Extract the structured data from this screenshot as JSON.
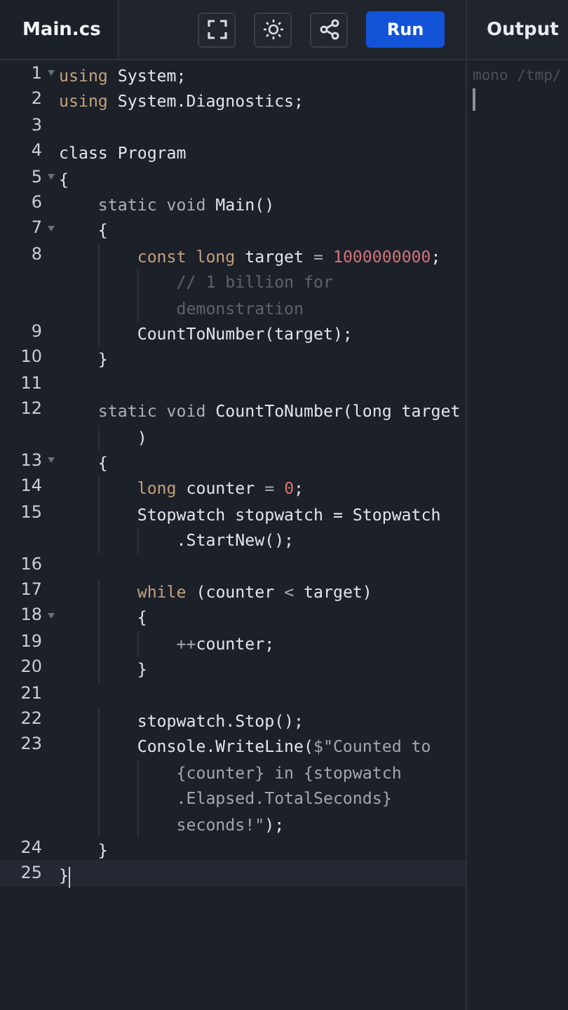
{
  "tab": {
    "label": "Main.cs",
    "selected": true
  },
  "toolbar": {
    "buttons": [
      {
        "kind": "fullscreen"
      },
      {
        "kind": "theme"
      },
      {
        "kind": "share"
      }
    ],
    "run": "Run"
  },
  "editor": {
    "lines": [
      {
        "number": "1",
        "foldable": true,
        "active": false,
        "segments": [
          {
            "tokens": [
              {
                "kind": "kw",
                "text": "using"
              },
              {
                "kind": "plain",
                "text": " System;"
              }
            ]
          }
        ]
      },
      {
        "number": "2",
        "foldable": false,
        "active": false,
        "segments": [
          {
            "tokens": [
              {
                "kind": "kw",
                "text": "using"
              },
              {
                "kind": "plain",
                "text": " System.Diagnostics;"
              }
            ]
          }
        ]
      },
      {
        "number": "3",
        "foldable": false,
        "active": false
      },
      {
        "number": "4",
        "foldable": false,
        "active": false,
        "segments": [
          {
            "tokens": [
              {
                "kind": "plain",
                "text": "class Program"
              }
            ]
          }
        ]
      },
      {
        "number": "5",
        "foldable": true,
        "active": false,
        "segments": [
          {
            "tokens": [
              {
                "kind": "plain",
                "text": "{"
              }
            ]
          }
        ]
      },
      {
        "number": "6",
        "foldable": false,
        "active": false,
        "segments": [
          {
            "tokens": [
              {
                "kind": "decl",
                "text": "    static void"
              },
              {
                "kind": "plain",
                "text": " Main()"
              }
            ]
          }
        ]
      },
      {
        "number": "7",
        "foldable": true,
        "active": false,
        "segments": [
          {
            "tokens": [
              {
                "kind": "plain",
                "text": "    {"
              }
            ]
          }
        ]
      },
      {
        "number": "8",
        "foldable": false,
        "active": false,
        "segments": [
          {
            "tokens": [
              {
                "kind": "kw",
                "text": "        const long"
              },
              {
                "kind": "plain",
                "text": " target "
              },
              {
                "kind": "op",
                "text": "= "
              },
              {
                "kind": "num",
                "text": "1000000000"
              },
              {
                "kind": "plain",
                "text": ";"
              }
            ]
          },
          {
            "tokens": [
              {
                "kind": "comment",
                "text": "            // 1 billion for"
              }
            ]
          },
          {
            "tokens": [
              {
                "kind": "comment",
                "text": "            demonstration"
              }
            ]
          }
        ]
      },
      {
        "number": "9",
        "foldable": false,
        "active": false,
        "segments": [
          {
            "tokens": [
              {
                "kind": "plain",
                "text": "        CountToNumber(target);"
              }
            ]
          }
        ]
      },
      {
        "number": "10",
        "foldable": false,
        "active": false,
        "segments": [
          {
            "tokens": [
              {
                "kind": "plain",
                "text": "    }"
              }
            ]
          }
        ]
      },
      {
        "number": "11",
        "foldable": false,
        "active": false
      },
      {
        "number": "12",
        "foldable": false,
        "active": false,
        "segments": [
          {
            "tokens": [
              {
                "kind": "decl",
                "text": "    static void"
              },
              {
                "kind": "plain",
                "text": " CountToNumber(long target"
              }
            ]
          },
          {
            "tokens": [
              {
                "kind": "plain",
                "text": "        )"
              }
            ]
          }
        ]
      },
      {
        "number": "13",
        "foldable": true,
        "active": false,
        "segments": [
          {
            "tokens": [
              {
                "kind": "plain",
                "text": "    {"
              }
            ]
          }
        ]
      },
      {
        "number": "14",
        "foldable": false,
        "active": false,
        "segments": [
          {
            "tokens": [
              {
                "kind": "kw",
                "text": "        long"
              },
              {
                "kind": "plain",
                "text": " counter "
              },
              {
                "kind": "op",
                "text": "= "
              },
              {
                "kind": "num",
                "text": "0"
              },
              {
                "kind": "plain",
                "text": ";"
              }
            ]
          }
        ]
      },
      {
        "number": "15",
        "foldable": false,
        "active": false,
        "segments": [
          {
            "tokens": [
              {
                "kind": "plain",
                "text": "        Stopwatch stopwatch = Stopwatch"
              }
            ]
          },
          {
            "tokens": [
              {
                "kind": "plain",
                "text": "            .StartNew();"
              }
            ]
          }
        ]
      },
      {
        "number": "16",
        "foldable": false,
        "active": false
      },
      {
        "number": "17",
        "foldable": false,
        "active": false,
        "segments": [
          {
            "tokens": [
              {
                "kind": "kw",
                "text": "        while"
              },
              {
                "kind": "plain",
                "text": " (counter "
              },
              {
                "kind": "op",
                "text": "<"
              },
              {
                "kind": "plain",
                "text": " target)"
              }
            ]
          }
        ]
      },
      {
        "number": "18",
        "foldable": true,
        "active": false,
        "segments": [
          {
            "tokens": [
              {
                "kind": "plain",
                "text": "        {"
              }
            ]
          }
        ]
      },
      {
        "number": "19",
        "foldable": false,
        "active": false,
        "segments": [
          {
            "tokens": [
              {
                "kind": "op",
                "text": "            ++"
              },
              {
                "kind": "plain",
                "text": "counter;"
              }
            ]
          }
        ]
      },
      {
        "number": "20",
        "foldable": false,
        "active": false,
        "segments": [
          {
            "tokens": [
              {
                "kind": "plain",
                "text": "        }"
              }
            ]
          }
        ]
      },
      {
        "number": "21",
        "foldable": false,
        "active": false
      },
      {
        "number": "22",
        "foldable": false,
        "active": false,
        "segments": [
          {
            "tokens": [
              {
                "kind": "plain",
                "text": "        stopwatch.Stop();"
              }
            ]
          }
        ]
      },
      {
        "number": "23",
        "foldable": false,
        "active": false,
        "segments": [
          {
            "tokens": [
              {
                "kind": "plain",
                "text": "        Console.WriteLine("
              },
              {
                "kind": "str",
                "text": "$\"Counted to"
              }
            ]
          },
          {
            "tokens": [
              {
                "kind": "str",
                "text": "            {counter} in {stopwatch"
              }
            ]
          },
          {
            "tokens": [
              {
                "kind": "str",
                "text": "            .Elapsed.TotalSeconds}"
              }
            ]
          },
          {
            "tokens": [
              {
                "kind": "str",
                "text": "            seconds!\""
              },
              {
                "kind": "plain",
                "text": ");"
              }
            ]
          }
        ]
      },
      {
        "number": "24",
        "foldable": false,
        "active": false,
        "segments": [
          {
            "tokens": [
              {
                "kind": "plain",
                "text": "    }"
              }
            ]
          }
        ]
      },
      {
        "number": "25",
        "foldable": false,
        "active": true,
        "segments": [
          {
            "tokens": [
              {
                "kind": "plain",
                "text": "}"
              }
            ]
          }
        ]
      }
    ]
  },
  "output": {
    "title": "Output",
    "lines": [
      "mono /tmp/"
    ]
  }
}
